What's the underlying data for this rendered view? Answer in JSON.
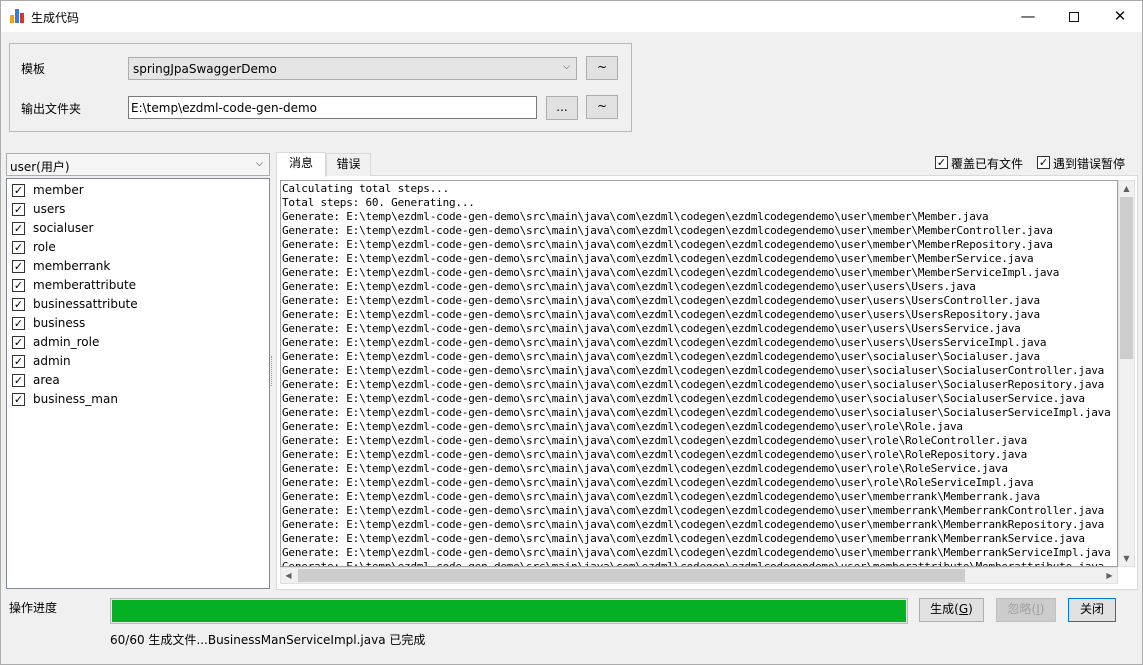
{
  "window": {
    "title": "生成代码",
    "minimize_glyph": "—",
    "close_glyph": "✕"
  },
  "template": {
    "label": "模板",
    "selected": "springJpaSwaggerDemo",
    "btn": "~"
  },
  "output": {
    "label": "输出文件夹",
    "value": "E:\\temp\\ezdml-code-gen-demo",
    "browse_btn": "...",
    "btn": "~"
  },
  "entity_selector": {
    "selected": "user(用户)"
  },
  "entity_list": [
    {
      "label": "member",
      "checked": true
    },
    {
      "label": "users",
      "checked": true
    },
    {
      "label": "socialuser",
      "checked": true
    },
    {
      "label": "role",
      "checked": true
    },
    {
      "label": "memberrank",
      "checked": true
    },
    {
      "label": "memberattribute",
      "checked": true
    },
    {
      "label": "businessattribute",
      "checked": true
    },
    {
      "label": "business",
      "checked": true
    },
    {
      "label": "admin_role",
      "checked": true
    },
    {
      "label": "admin",
      "checked": true
    },
    {
      "label": "area",
      "checked": true
    },
    {
      "label": "business_man",
      "checked": true
    }
  ],
  "tabs": {
    "messages": "消息",
    "errors": "错误"
  },
  "options": {
    "overwrite": "覆盖已有文件",
    "pause_on_error": "遇到错误暂停"
  },
  "log_lines": [
    "Calculating total steps...",
    "Total steps: 60. Generating...",
    "Generate: E:\\temp\\ezdml-code-gen-demo\\src\\main\\java\\com\\ezdml\\codegen\\ezdmlcodegendemo\\user\\member\\Member.java",
    "Generate: E:\\temp\\ezdml-code-gen-demo\\src\\main\\java\\com\\ezdml\\codegen\\ezdmlcodegendemo\\user\\member\\MemberController.java",
    "Generate: E:\\temp\\ezdml-code-gen-demo\\src\\main\\java\\com\\ezdml\\codegen\\ezdmlcodegendemo\\user\\member\\MemberRepository.java",
    "Generate: E:\\temp\\ezdml-code-gen-demo\\src\\main\\java\\com\\ezdml\\codegen\\ezdmlcodegendemo\\user\\member\\MemberService.java",
    "Generate: E:\\temp\\ezdml-code-gen-demo\\src\\main\\java\\com\\ezdml\\codegen\\ezdmlcodegendemo\\user\\member\\MemberServiceImpl.java",
    "Generate: E:\\temp\\ezdml-code-gen-demo\\src\\main\\java\\com\\ezdml\\codegen\\ezdmlcodegendemo\\user\\users\\Users.java",
    "Generate: E:\\temp\\ezdml-code-gen-demo\\src\\main\\java\\com\\ezdml\\codegen\\ezdmlcodegendemo\\user\\users\\UsersController.java",
    "Generate: E:\\temp\\ezdml-code-gen-demo\\src\\main\\java\\com\\ezdml\\codegen\\ezdmlcodegendemo\\user\\users\\UsersRepository.java",
    "Generate: E:\\temp\\ezdml-code-gen-demo\\src\\main\\java\\com\\ezdml\\codegen\\ezdmlcodegendemo\\user\\users\\UsersService.java",
    "Generate: E:\\temp\\ezdml-code-gen-demo\\src\\main\\java\\com\\ezdml\\codegen\\ezdmlcodegendemo\\user\\users\\UsersServiceImpl.java",
    "Generate: E:\\temp\\ezdml-code-gen-demo\\src\\main\\java\\com\\ezdml\\codegen\\ezdmlcodegendemo\\user\\socialuser\\Socialuser.java",
    "Generate: E:\\temp\\ezdml-code-gen-demo\\src\\main\\java\\com\\ezdml\\codegen\\ezdmlcodegendemo\\user\\socialuser\\SocialuserController.java",
    "Generate: E:\\temp\\ezdml-code-gen-demo\\src\\main\\java\\com\\ezdml\\codegen\\ezdmlcodegendemo\\user\\socialuser\\SocialuserRepository.java",
    "Generate: E:\\temp\\ezdml-code-gen-demo\\src\\main\\java\\com\\ezdml\\codegen\\ezdmlcodegendemo\\user\\socialuser\\SocialuserService.java",
    "Generate: E:\\temp\\ezdml-code-gen-demo\\src\\main\\java\\com\\ezdml\\codegen\\ezdmlcodegendemo\\user\\socialuser\\SocialuserServiceImpl.java",
    "Generate: E:\\temp\\ezdml-code-gen-demo\\src\\main\\java\\com\\ezdml\\codegen\\ezdmlcodegendemo\\user\\role\\Role.java",
    "Generate: E:\\temp\\ezdml-code-gen-demo\\src\\main\\java\\com\\ezdml\\codegen\\ezdmlcodegendemo\\user\\role\\RoleController.java",
    "Generate: E:\\temp\\ezdml-code-gen-demo\\src\\main\\java\\com\\ezdml\\codegen\\ezdmlcodegendemo\\user\\role\\RoleRepository.java",
    "Generate: E:\\temp\\ezdml-code-gen-demo\\src\\main\\java\\com\\ezdml\\codegen\\ezdmlcodegendemo\\user\\role\\RoleService.java",
    "Generate: E:\\temp\\ezdml-code-gen-demo\\src\\main\\java\\com\\ezdml\\codegen\\ezdmlcodegendemo\\user\\role\\RoleServiceImpl.java",
    "Generate: E:\\temp\\ezdml-code-gen-demo\\src\\main\\java\\com\\ezdml\\codegen\\ezdmlcodegendemo\\user\\memberrank\\Memberrank.java",
    "Generate: E:\\temp\\ezdml-code-gen-demo\\src\\main\\java\\com\\ezdml\\codegen\\ezdmlcodegendemo\\user\\memberrank\\MemberrankController.java",
    "Generate: E:\\temp\\ezdml-code-gen-demo\\src\\main\\java\\com\\ezdml\\codegen\\ezdmlcodegendemo\\user\\memberrank\\MemberrankRepository.java",
    "Generate: E:\\temp\\ezdml-code-gen-demo\\src\\main\\java\\com\\ezdml\\codegen\\ezdmlcodegendemo\\user\\memberrank\\MemberrankService.java",
    "Generate: E:\\temp\\ezdml-code-gen-demo\\src\\main\\java\\com\\ezdml\\codegen\\ezdmlcodegendemo\\user\\memberrank\\MemberrankServiceImpl.java",
    "Generate: E:\\temp\\ezdml-code-gen-demo\\src\\main\\java\\com\\ezdml\\codegen\\ezdmlcodegendemo\\user\\memberattribute\\Memberattribute.java"
  ],
  "scroll": {
    "up": "▲",
    "down": "▼",
    "left": "◀",
    "right": "▶"
  },
  "progress": {
    "label": "操作进度",
    "value": 60,
    "total": 60,
    "fraction": 1.0,
    "status": "60/60 生成文件...BusinessManServiceImpl.java 已完成",
    "bar_color": "#06b025"
  },
  "buttons": {
    "generate": "生成",
    "generate_key": "G",
    "ignore": "忽略",
    "ignore_key": "I",
    "close": "关闭"
  },
  "check_glyph": "✓"
}
